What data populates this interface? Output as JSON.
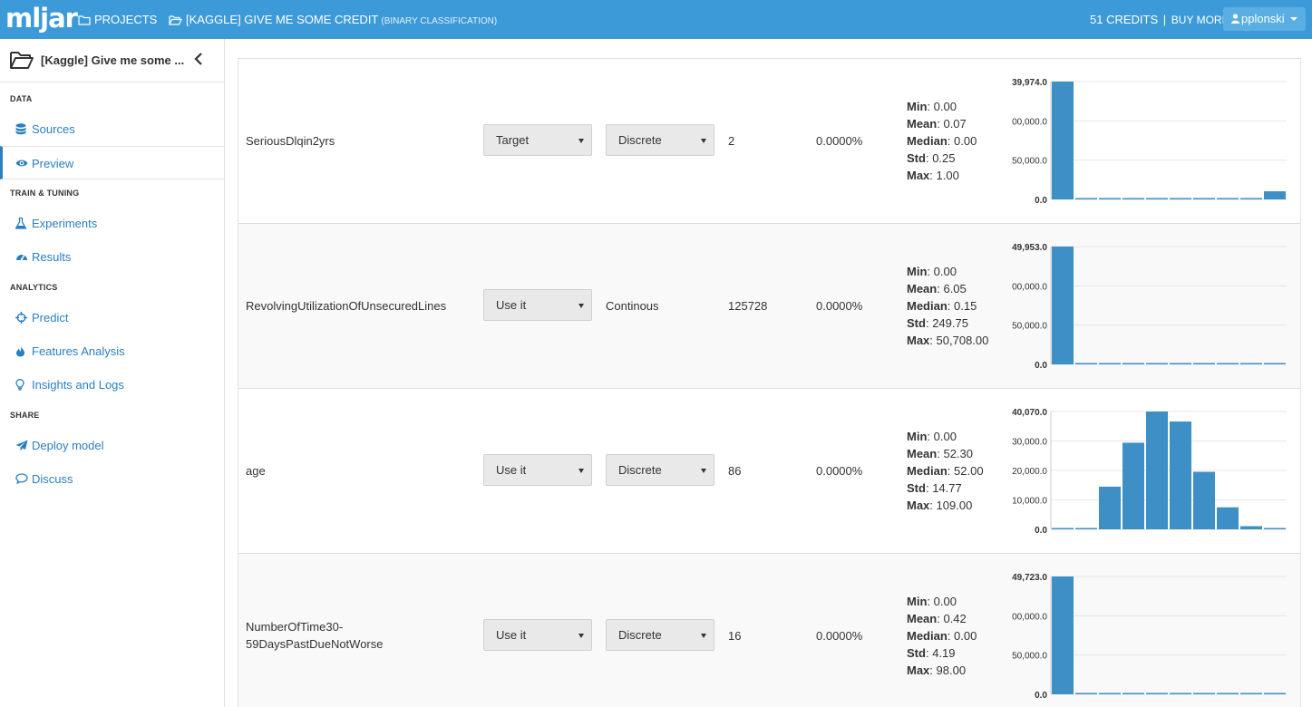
{
  "navbar": {
    "logo": "mljar",
    "projects": "PROJECTS",
    "project": "[KAGGLE] GIVE ME SOME CREDIT",
    "project_type": "(BINARY CLASSIFICATION)",
    "credits": "51 CREDITS",
    "separator": "|",
    "buy_more": "BUY MORE",
    "user": "pplonski"
  },
  "sidebar": {
    "project_name": "[Kaggle] Give me some ...",
    "sections": [
      {
        "title": "DATA",
        "items": [
          {
            "label": "Sources",
            "icon": "database-icon"
          },
          {
            "label": "Preview",
            "icon": "eye-icon",
            "active": true
          }
        ]
      },
      {
        "title": "TRAIN & TUNING",
        "items": [
          {
            "label": "Experiments",
            "icon": "flask-icon"
          },
          {
            "label": "Results",
            "icon": "dashboard-icon"
          }
        ]
      },
      {
        "title": "ANALYTICS",
        "items": [
          {
            "label": "Predict",
            "icon": "crosshairs-icon"
          },
          {
            "label": "Features Analysis",
            "icon": "fire-icon"
          },
          {
            "label": "Insights and Logs",
            "icon": "lightbulb-icon"
          }
        ]
      },
      {
        "title": "SHARE",
        "items": [
          {
            "label": "Deploy model",
            "icon": "paper-plane-icon"
          },
          {
            "label": "Discuss",
            "icon": "comment-icon"
          }
        ]
      }
    ]
  },
  "colors": {
    "navbar": "#3d9ad8",
    "accent": "#2a7fc0",
    "bar": "#3d8fc6"
  },
  "features": [
    {
      "name": "SeriousDlqin2yrs",
      "usage": "Target",
      "type": "Discrete",
      "type_is_select": true,
      "unique": "2",
      "missing": "0.0000%",
      "stats": {
        "min": "0.00",
        "mean": "0.07",
        "median": "0.00",
        "std": "0.25",
        "max": "1.00"
      },
      "chart_data": {
        "type": "bar",
        "ylim_label": "39,974.0",
        "tick_labels": [
          "39,974.0",
          "00,000.0",
          "50,000.0",
          "0.0"
        ],
        "values": [
          1,
          0.004,
          0.004,
          0.004,
          0.004,
          0.004,
          0.004,
          0.004,
          0.004,
          0.069
        ]
      }
    },
    {
      "name": "RevolvingUtilizationOfUnsecuredLines",
      "usage": "Use it",
      "type": "Continous",
      "type_is_select": false,
      "unique": "125728",
      "missing": "0.0000%",
      "stats": {
        "min": "0.00",
        "mean": "6.05",
        "median": "0.15",
        "std": "249.75",
        "max": "50,708.00"
      },
      "chart_data": {
        "type": "bar",
        "tick_labels": [
          "49,953.0",
          "00,000.0",
          "50,000.0",
          "0.0"
        ],
        "values": [
          1,
          0.004,
          0.004,
          0.004,
          0.004,
          0.004,
          0.004,
          0.004,
          0.004,
          0.004
        ]
      }
    },
    {
      "name": "age",
      "usage": "Use it",
      "type": "Discrete",
      "type_is_select": true,
      "unique": "86",
      "missing": "0.0000%",
      "stats": {
        "min": "0.00",
        "mean": "52.30",
        "median": "52.00",
        "std": "14.77",
        "max": "109.00"
      },
      "chart_data": {
        "type": "bar",
        "tick_labels": [
          "40,070.0",
          "30,000.0",
          "20,000.0",
          "10,000.0",
          "0.0"
        ],
        "values": [
          0.004,
          0.004,
          0.362,
          0.735,
          1,
          0.915,
          0.488,
          0.187,
          0.027,
          0.004
        ]
      }
    },
    {
      "name": "NumberOfTime30-\n59DaysPastDueNotWorse",
      "usage": "Use it",
      "type": "Discrete",
      "type_is_select": true,
      "unique": "16",
      "missing": "0.0000%",
      "stats": {
        "min": "0.00",
        "mean": "0.42",
        "median": "0.00",
        "std": "4.19",
        "max": "98.00"
      },
      "chart_data": {
        "type": "bar",
        "tick_labels": [
          "49,723.0",
          "00,000.0",
          "50,000.0",
          "0.0"
        ],
        "values": [
          1,
          0.004,
          0.004,
          0.004,
          0.004,
          0.004,
          0.004,
          0.004,
          0.004,
          0.004
        ]
      }
    }
  ],
  "stat_labels": {
    "min": "Min",
    "mean": "Mean",
    "median": "Median",
    "std": "Std",
    "max": "Max"
  }
}
